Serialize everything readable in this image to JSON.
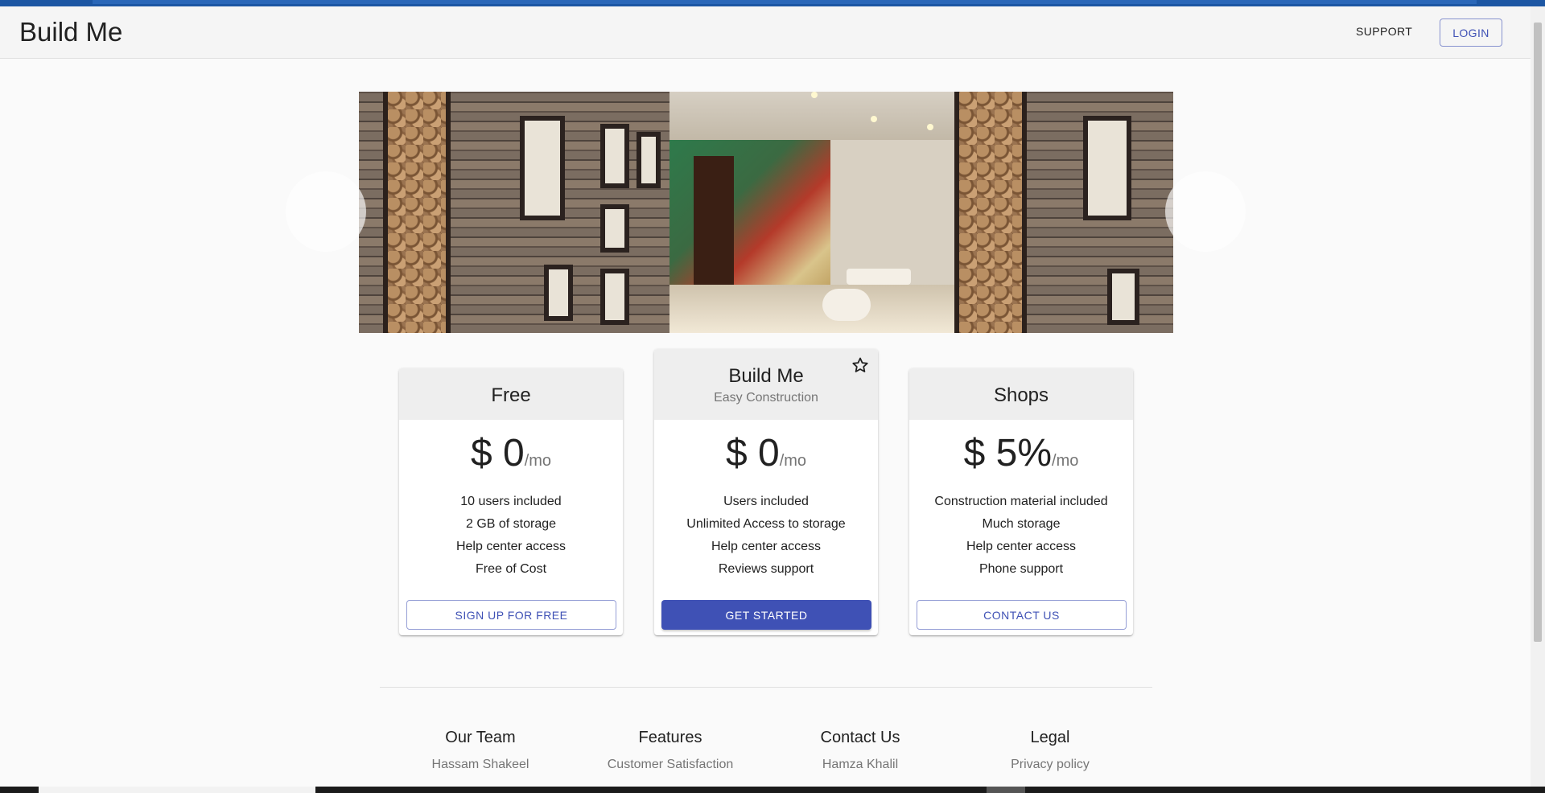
{
  "app": {
    "brand": "Build Me",
    "nav": {
      "support": "SUPPORT",
      "login": "LOGIN"
    }
  },
  "carousel": {
    "prev_icon": "chevron-left-icon",
    "next_icon": "chevron-right-icon"
  },
  "plans": [
    {
      "title": "Free",
      "subheader": "",
      "price": "$ 0",
      "period": "/mo",
      "features": [
        "10 users included",
        "2 GB of storage",
        "Help center access",
        "Free of Cost"
      ],
      "button": "SIGN UP FOR FREE",
      "variant": "outlined"
    },
    {
      "title": "Build Me",
      "subheader": "Easy Construction",
      "price": "$ 0",
      "period": "/mo",
      "features": [
        "Users included",
        "Unlimited Access to storage",
        "Help center access",
        "Reviews support"
      ],
      "button": "GET STARTED",
      "variant": "contained",
      "icon": "star-icon"
    },
    {
      "title": "Shops",
      "subheader": "",
      "price": "$ 5%",
      "period": "/mo",
      "features": [
        "Construction material included",
        "Much storage",
        "Help center access",
        "Phone support"
      ],
      "button": "CONTACT US",
      "variant": "outlined"
    }
  ],
  "footer": [
    {
      "heading": "Our Team",
      "link": "Hassam Shakeel"
    },
    {
      "heading": "Features",
      "link": "Customer Satisfaction"
    },
    {
      "heading": "Contact Us",
      "link": "Hamza Khalil"
    },
    {
      "heading": "Legal",
      "link": "Privacy policy"
    }
  ],
  "colors": {
    "primary": "#3f51b5",
    "appbar": "#f5f5f5",
    "card_header": "#eeeeee",
    "browser_strip": "#1c56a3"
  }
}
